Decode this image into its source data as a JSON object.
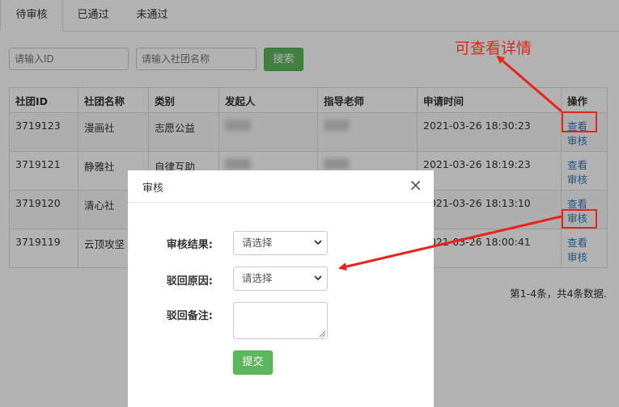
{
  "tabs": [
    {
      "label": "待审核",
      "active": true
    },
    {
      "label": "已通过",
      "active": false
    },
    {
      "label": "未通过",
      "active": false
    }
  ],
  "search": {
    "id_placeholder": "请输入ID",
    "name_placeholder": "请输入社团名称",
    "button_label": "搜索"
  },
  "table": {
    "headers": [
      "社团ID",
      "社团名称",
      "类别",
      "发起人",
      "指导老师",
      "申请时间",
      "操作"
    ],
    "rows": [
      {
        "id": "3719123",
        "name": "漫画社",
        "category": "志愿公益",
        "time": "2021-03-26 18:30:23"
      },
      {
        "id": "3719121",
        "name": "静雅社",
        "category": "自律互助",
        "time": "2021-03-26 18:19:23"
      },
      {
        "id": "3719120",
        "name": "清心社",
        "category": "",
        "time": "2021-03-26 18:13:10"
      },
      {
        "id": "3719119",
        "name": "云顶攻坚",
        "category": "",
        "time": "2021-03-26 18:00:41"
      }
    ],
    "view_label": "查看",
    "review_label": "审核"
  },
  "pager": {
    "text": "第1-4条，共4条数据."
  },
  "modal": {
    "title": "审核",
    "close_glyph": "×",
    "result_label": "审核结果:",
    "result_value": "请选择",
    "reason_label": "驳回原因:",
    "reason_value": "请选择",
    "remark_label": "驳回备注:",
    "submit_label": "提交"
  },
  "annotation": {
    "text": "可查看详情",
    "color": "#e8231b"
  },
  "colors": {
    "accent_green": "#5cb85c",
    "link_blue": "#337ab7"
  }
}
